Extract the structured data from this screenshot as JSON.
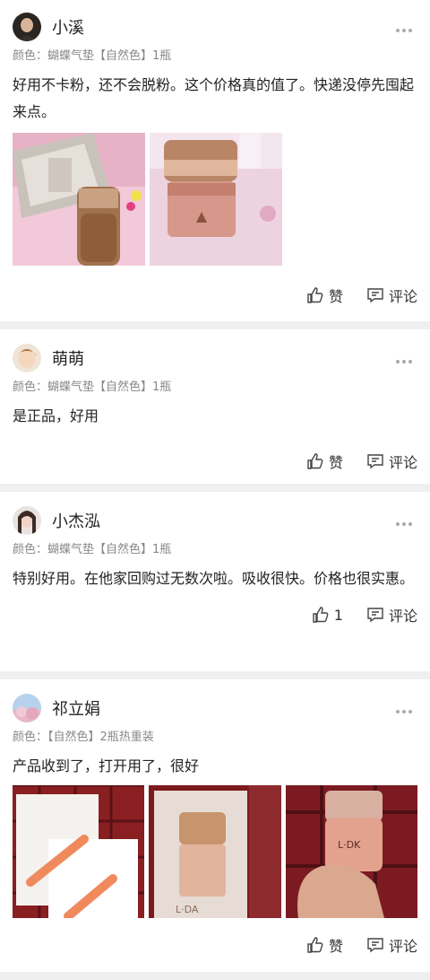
{
  "reviews": [
    {
      "user": "小溪",
      "sku": "颜色：蝴蝶气垫【自然色】1瓶",
      "content": "好用不卡粉，还不会脱粉。这个价格真的值了。快递没停先囤起来点。",
      "like_label": "赞",
      "comment_label": "评论"
    },
    {
      "user": "萌萌",
      "sku": "颜色：蝴蝶气垫【自然色】1瓶",
      "content": "是正品，好用",
      "like_label": "赞",
      "comment_label": "评论"
    },
    {
      "user": "小杰泓",
      "sku": "颜色：蝴蝶气垫【自然色】1瓶",
      "content": "特别好用。在他家回购过无数次啦。吸收很快。价格也很实惠。",
      "like_label": "1",
      "comment_label": "评论"
    },
    {
      "user": "祁立娟",
      "sku": "颜色：【自然色】2瓶热重装",
      "content": "产品收到了，打开用了，很好",
      "like_label": "赞",
      "comment_label": "评论"
    }
  ],
  "photo_texts": {
    "box_brand": "L·DA",
    "bottle_brand": "L·DK"
  },
  "icons": {
    "like": "thumbs-up-icon",
    "comment": "comment-icon",
    "more": "more-dots-icon"
  }
}
